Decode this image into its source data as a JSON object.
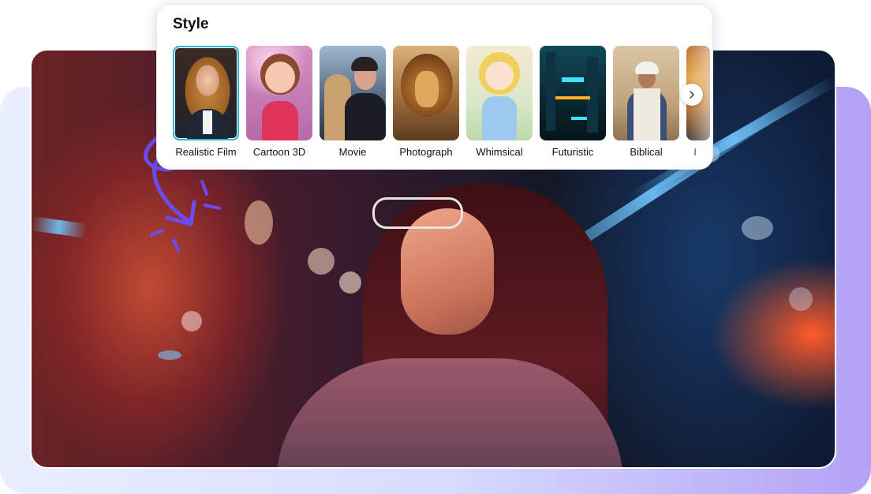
{
  "panel": {
    "title": "Style",
    "styles": [
      {
        "label": "Realistic Film",
        "selected": true
      },
      {
        "label": "Cartoon 3D",
        "selected": false
      },
      {
        "label": "Movie",
        "selected": false
      },
      {
        "label": "Photograph",
        "selected": false
      },
      {
        "label": "Whimsical",
        "selected": false
      },
      {
        "label": "Futuristic",
        "selected": false
      },
      {
        "label": "Biblical",
        "selected": false
      }
    ],
    "partial_label": "I",
    "next_icon": "chevron-right-icon"
  },
  "colors": {
    "selected_border": "#2ab9d8",
    "doodle": "#6b4cf0"
  }
}
